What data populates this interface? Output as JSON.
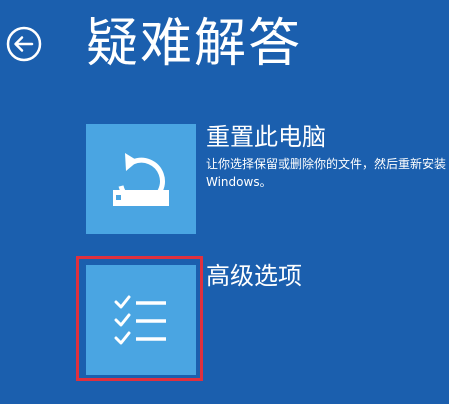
{
  "header": {
    "back_icon": "back-arrow-circle-icon",
    "title": "疑难解答"
  },
  "options": [
    {
      "icon": "reset-pc-icon",
      "title": "重置此电脑",
      "description": "让你选择保留或删除你的文件，然后重新安装 Windows。"
    },
    {
      "icon": "advanced-options-checklist-icon",
      "title": "高级选项",
      "selected": true
    }
  ],
  "colors": {
    "background": "#1b5fae",
    "tile": "#4aa5e2",
    "selection_border": "#e0303e",
    "text": "#ffffff"
  }
}
